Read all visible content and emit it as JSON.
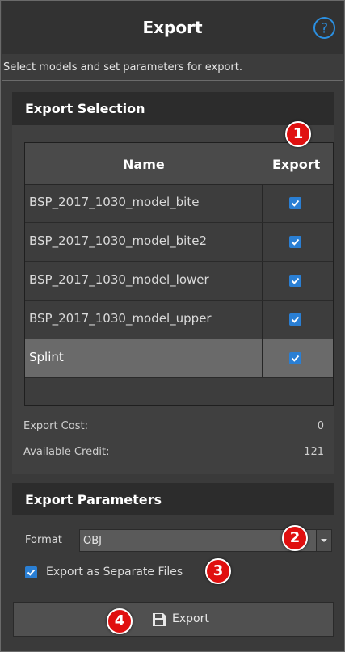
{
  "header": {
    "title": "Export"
  },
  "subtitle": "Select models and set parameters for export.",
  "selection": {
    "title": "Export Selection",
    "columns": [
      "Name",
      "Export"
    ],
    "rows": [
      {
        "name": "BSP_2017_1030_model_bite",
        "checked": true
      },
      {
        "name": "BSP_2017_1030_model_bite2",
        "checked": true
      },
      {
        "name": "BSP_2017_1030_model_lower",
        "checked": true
      },
      {
        "name": "BSP_2017_1030_model_upper",
        "checked": true
      },
      {
        "name": "Splint",
        "checked": true
      }
    ],
    "export_cost_label": "Export Cost:",
    "export_cost_value": "0",
    "available_credit_label": "Available Credit:",
    "available_credit_value": "121"
  },
  "parameters": {
    "title": "Export Parameters",
    "format_label": "Format",
    "format_value": "OBJ",
    "separate_files_label": "Export as Separate Files",
    "separate_files_checked": true
  },
  "export_button": {
    "label": "Export"
  },
  "badges": [
    "1",
    "2",
    "3",
    "4"
  ],
  "colors": {
    "accent": "#2a7fd4",
    "badge": "#e01010",
    "help": "#2b8fe0"
  }
}
